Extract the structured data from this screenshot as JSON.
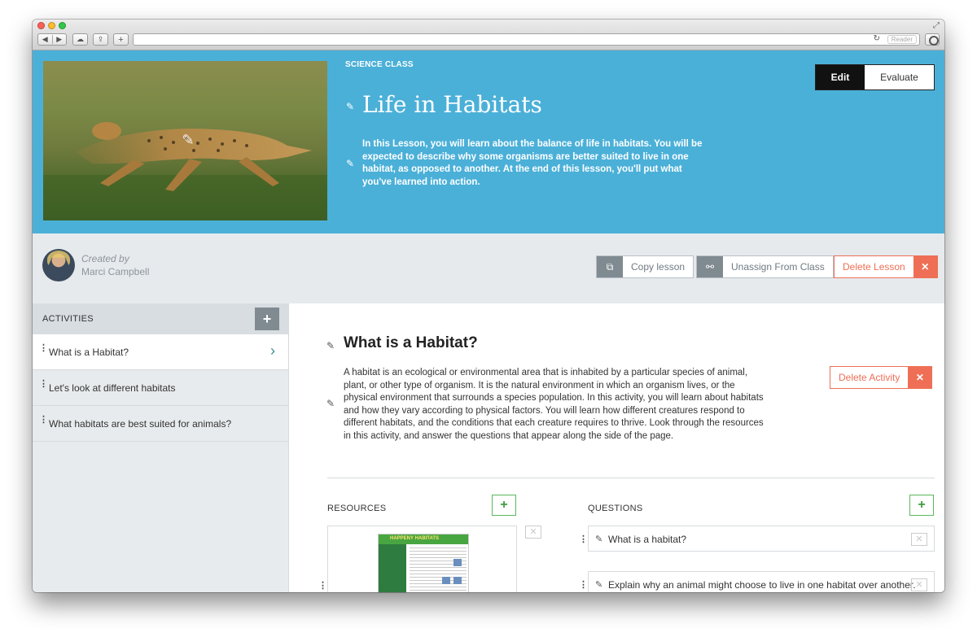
{
  "browser": {
    "reader_label": "Reader"
  },
  "hero": {
    "class_label": "SCIENCE CLASS",
    "title": "Life in Habitats",
    "description": "In this Lesson, you will learn about the balance of life in habitats. You will be expected to describe why some organisms are better suited to live in one habitat, as opposed to another. At the end of this lesson, you'll put what you've learned into action.",
    "image_icon": "cheetah-photo",
    "modes": {
      "edit": "Edit",
      "evaluate": "Evaluate"
    }
  },
  "author": {
    "created_by": "Created by",
    "name": "Marci Campbell"
  },
  "actions": {
    "copy": "Copy lesson",
    "unassign": "Unassign From Class",
    "delete": "Delete Lesson"
  },
  "sidebar": {
    "header": "ACTIVITIES",
    "items": [
      {
        "label": "What is a Habitat?"
      },
      {
        "label": "Let's look at different habitats"
      },
      {
        "label": "What habitats are best suited for animals?"
      }
    ]
  },
  "activity": {
    "title": "What is a Habitat?",
    "description": "A habitat is an ecological or environmental area that is inhabited by a particular species of animal, plant, or other type of organism. It is the natural environment in which an organism lives, or the physical environment that surrounds a species population. In this activity, you will learn about habitats and how they vary according to physical factors. You will learn how different creatures respond to different habitats, and the conditions that each creature requires to thrive. Look through the resources in this activity, and answer the questions that appear along the side of the page.",
    "delete": "Delete Activity",
    "resources_label": "RESOURCES",
    "questions_label": "QUESTIONS",
    "resource_thumb_title": "HAPPENY HABITATS",
    "questions": [
      {
        "text": "What is a habitat?"
      },
      {
        "text": "Explain why an animal might choose to live in one habitat over another."
      }
    ]
  },
  "colors": {
    "hero_bg": "#4bb0d8",
    "danger": "#ee6f56",
    "success": "#5cb85c",
    "neutral_btn": "#808a91"
  }
}
